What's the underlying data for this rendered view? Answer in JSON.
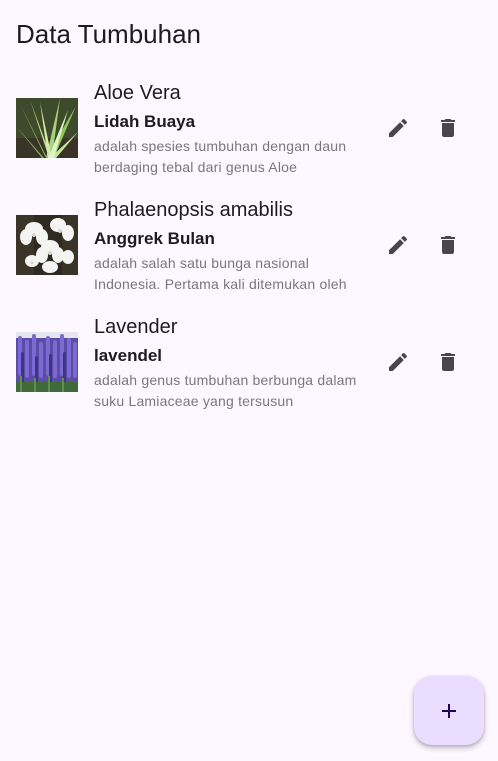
{
  "appbar": {
    "title": "Data Tumbuhan"
  },
  "plants": [
    {
      "name": "Aloe Vera",
      "local_name": "Lidah Buaya",
      "description": "adalah spesies tumbuhan dengan daun berdaging tebal dari genus Aloe",
      "image": "aloe-vera-photo"
    },
    {
      "name": "Phalaenopsis amabilis",
      "local_name": "Anggrek Bulan",
      "description": "adalah salah satu bunga nasional Indonesia. Pertama kali ditemukan oleh",
      "image": "orchid-photo"
    },
    {
      "name": "Lavender",
      "local_name": "lavendel",
      "description": "adalah genus tumbuhan berbunga dalam suku Lamiaceae yang tersusun",
      "image": "lavender-photo"
    }
  ],
  "actions": {
    "edit_icon": "pencil-icon",
    "delete_icon": "trash-icon",
    "add_icon": "plus-icon"
  },
  "colors": {
    "background": "#fdf7ff",
    "icon": "#49454f",
    "fab_background": "#ebddff",
    "fab_icon": "#21005d",
    "secondary_text": "#7a7580"
  }
}
